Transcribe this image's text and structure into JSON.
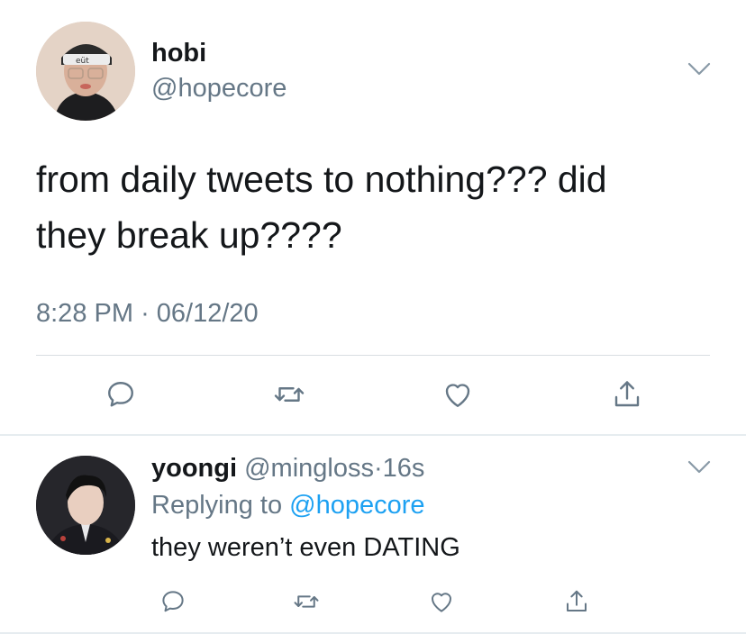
{
  "main_tweet": {
    "display_name": "hobi",
    "handle": "@hopecore",
    "text_line1": "from daily tweets to nothing??? did",
    "text_line2": "they break up????",
    "time": "8:28 PM",
    "separator": "·",
    "date": "06/12/20",
    "avatar_badge_text": "eüt"
  },
  "reply_tweet": {
    "display_name": "yoongi",
    "handle": "@mingloss",
    "separator": "·",
    "age": "16s",
    "replying_prefix": "Replying to",
    "replying_to": "@hopecore",
    "text": "they weren’t even DATING"
  },
  "icons": {
    "menu": "chevron-down-icon",
    "reply": "comment-bubble-icon",
    "retweet": "retweet-icon",
    "like": "heart-icon",
    "share": "share-upload-icon"
  },
  "colors": {
    "text": "#14171a",
    "muted": "#657786",
    "link": "#1da1f2",
    "divider": "#e6ecf0"
  }
}
